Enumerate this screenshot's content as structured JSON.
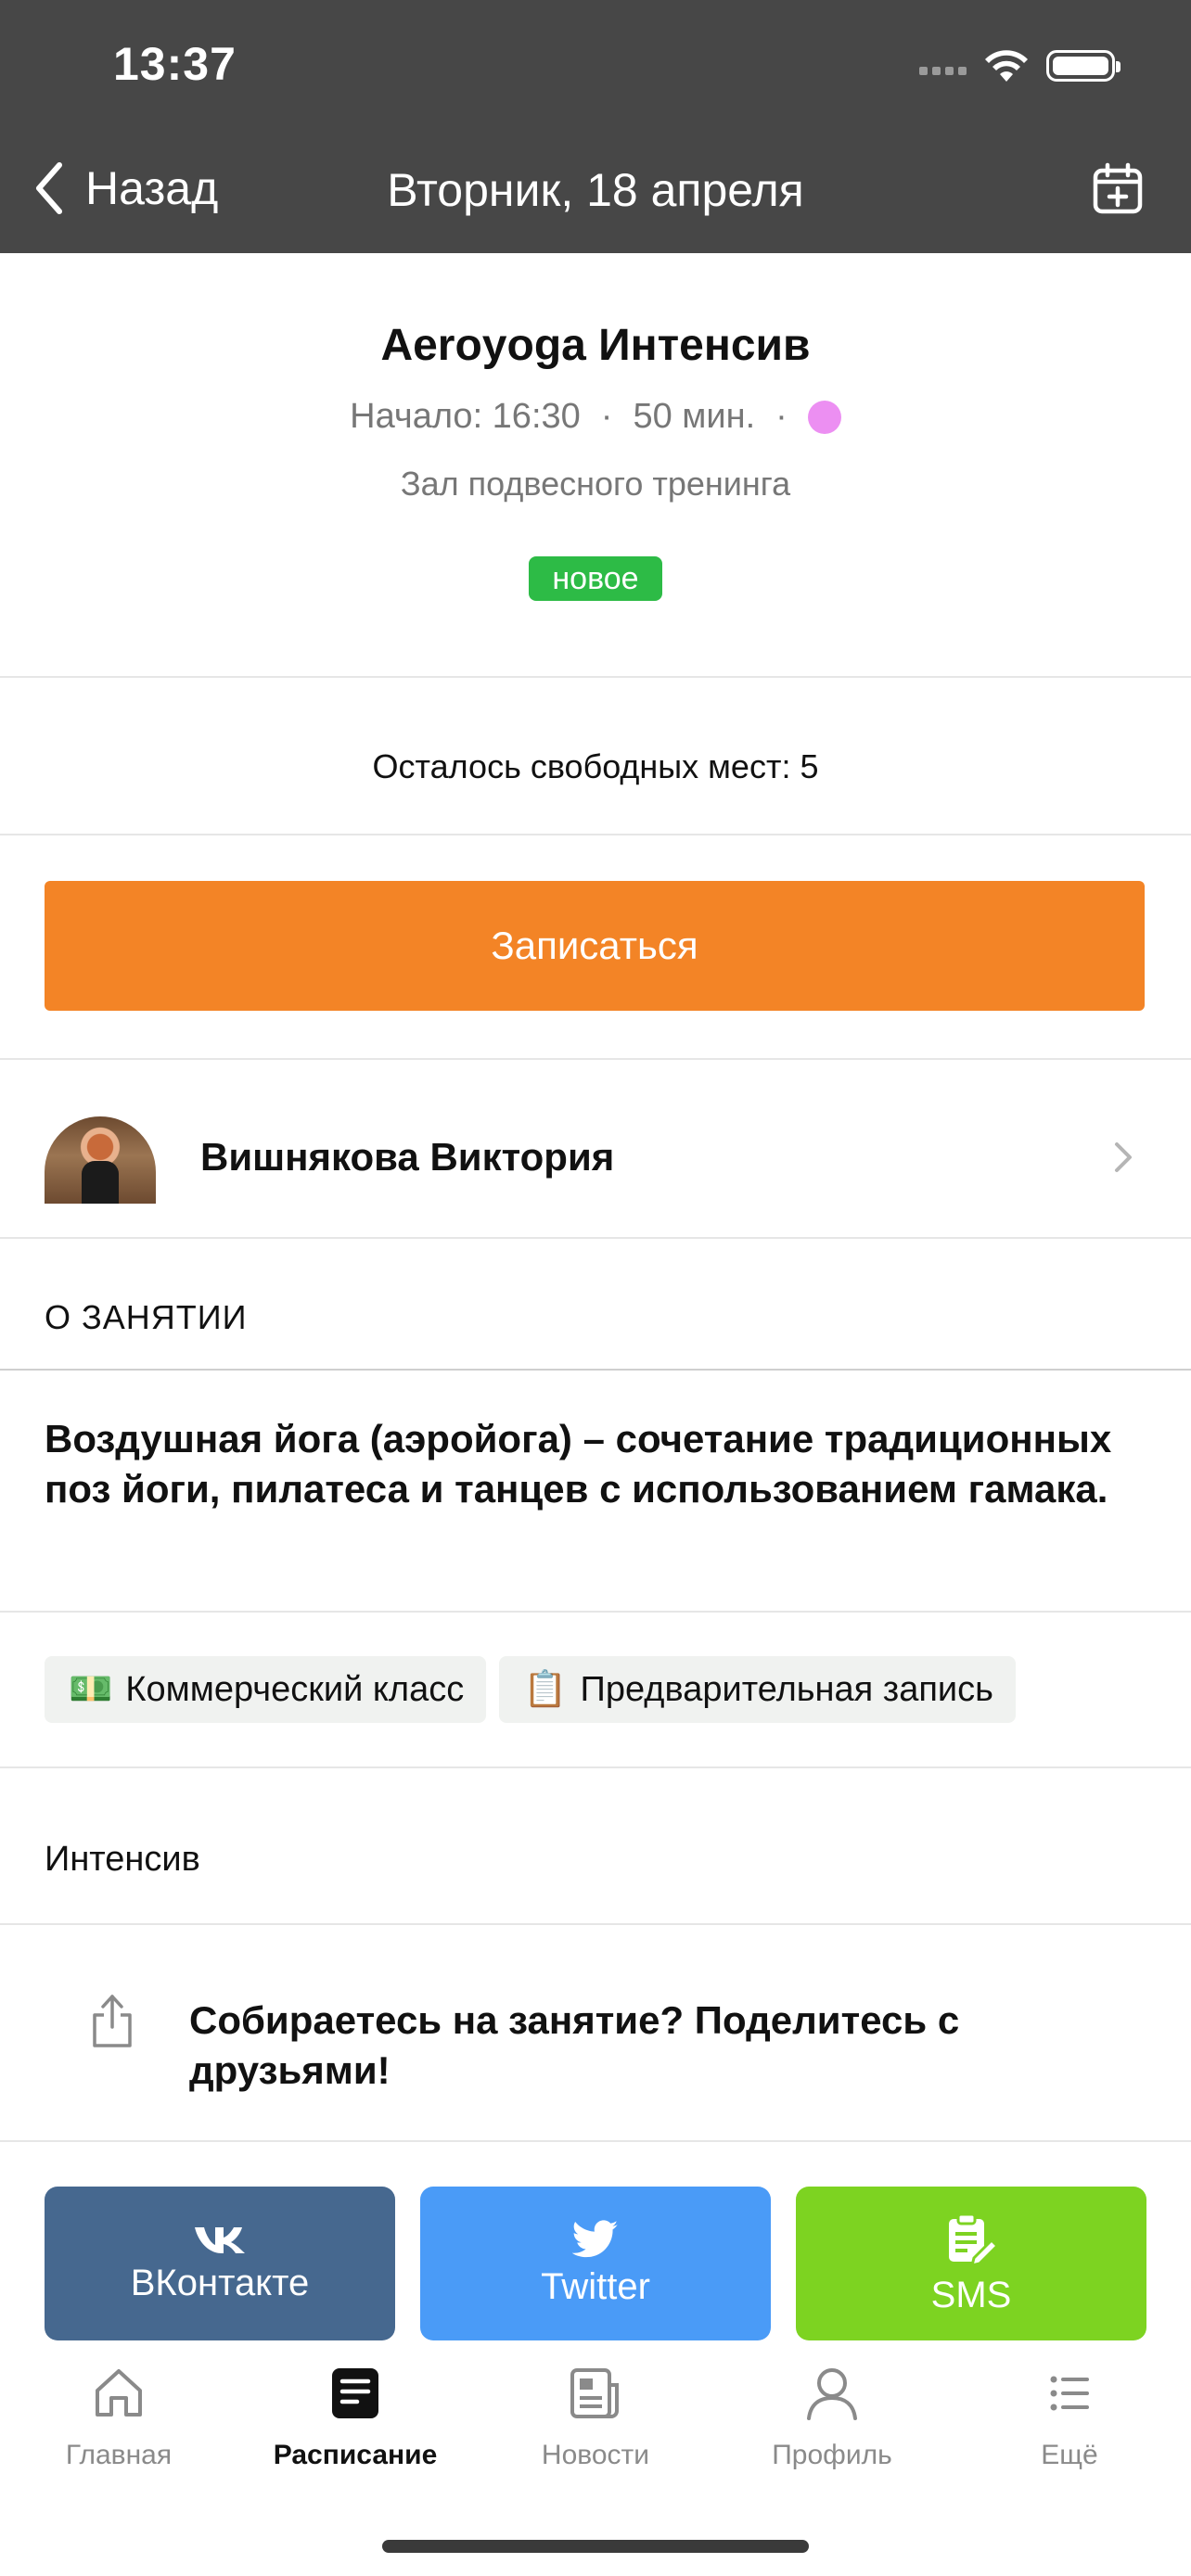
{
  "status_bar": {
    "time": "13:37"
  },
  "nav": {
    "back_label": "Назад",
    "title": "Вторник, 18 апреля"
  },
  "class": {
    "title": "Aeroyoga Интенсив",
    "start": "Начало: 16:30",
    "separator": "·",
    "duration": "50 мин.",
    "dot_color": "#ec8ff2",
    "hall": "Зал подвесного тренинга",
    "badge": "новое",
    "badge_color": "#2dbb46"
  },
  "free_places": "Осталось свободных мест: 5",
  "signup_button": {
    "label": "Записаться",
    "color": "#f38426"
  },
  "trainer": {
    "name": "Вишнякова Виктория"
  },
  "about": {
    "section_label": "О ЗАНЯТИИ",
    "description": "Воздушная йога (аэройога) – сочетание традиционных поз йоги, пилатеса и танцев с использованием гамака."
  },
  "tags": [
    {
      "emoji": "💵",
      "label": "Коммерческий класс"
    },
    {
      "emoji": "📋",
      "label": "Предварительная запись"
    }
  ],
  "tagline": "Интенсив",
  "share": {
    "prompt": "Собираетесь на занятие? Поделитесь с друзьями!",
    "buttons": [
      {
        "label": "ВКонтакте",
        "icon": "vk-icon",
        "color": "#46688f"
      },
      {
        "label": "Twitter",
        "icon": "twitter-icon",
        "color": "#4a9bf7"
      },
      {
        "label": "SMS",
        "icon": "sms-icon",
        "color": "#7dd321"
      }
    ]
  },
  "tabbar": {
    "items": [
      {
        "label": "Главная",
        "icon": "home-icon",
        "active": false
      },
      {
        "label": "Расписание",
        "icon": "schedule-icon",
        "active": true
      },
      {
        "label": "Новости",
        "icon": "news-icon",
        "active": false
      },
      {
        "label": "Профиль",
        "icon": "profile-icon",
        "active": false
      },
      {
        "label": "Ещё",
        "icon": "more-icon",
        "active": false
      }
    ]
  }
}
